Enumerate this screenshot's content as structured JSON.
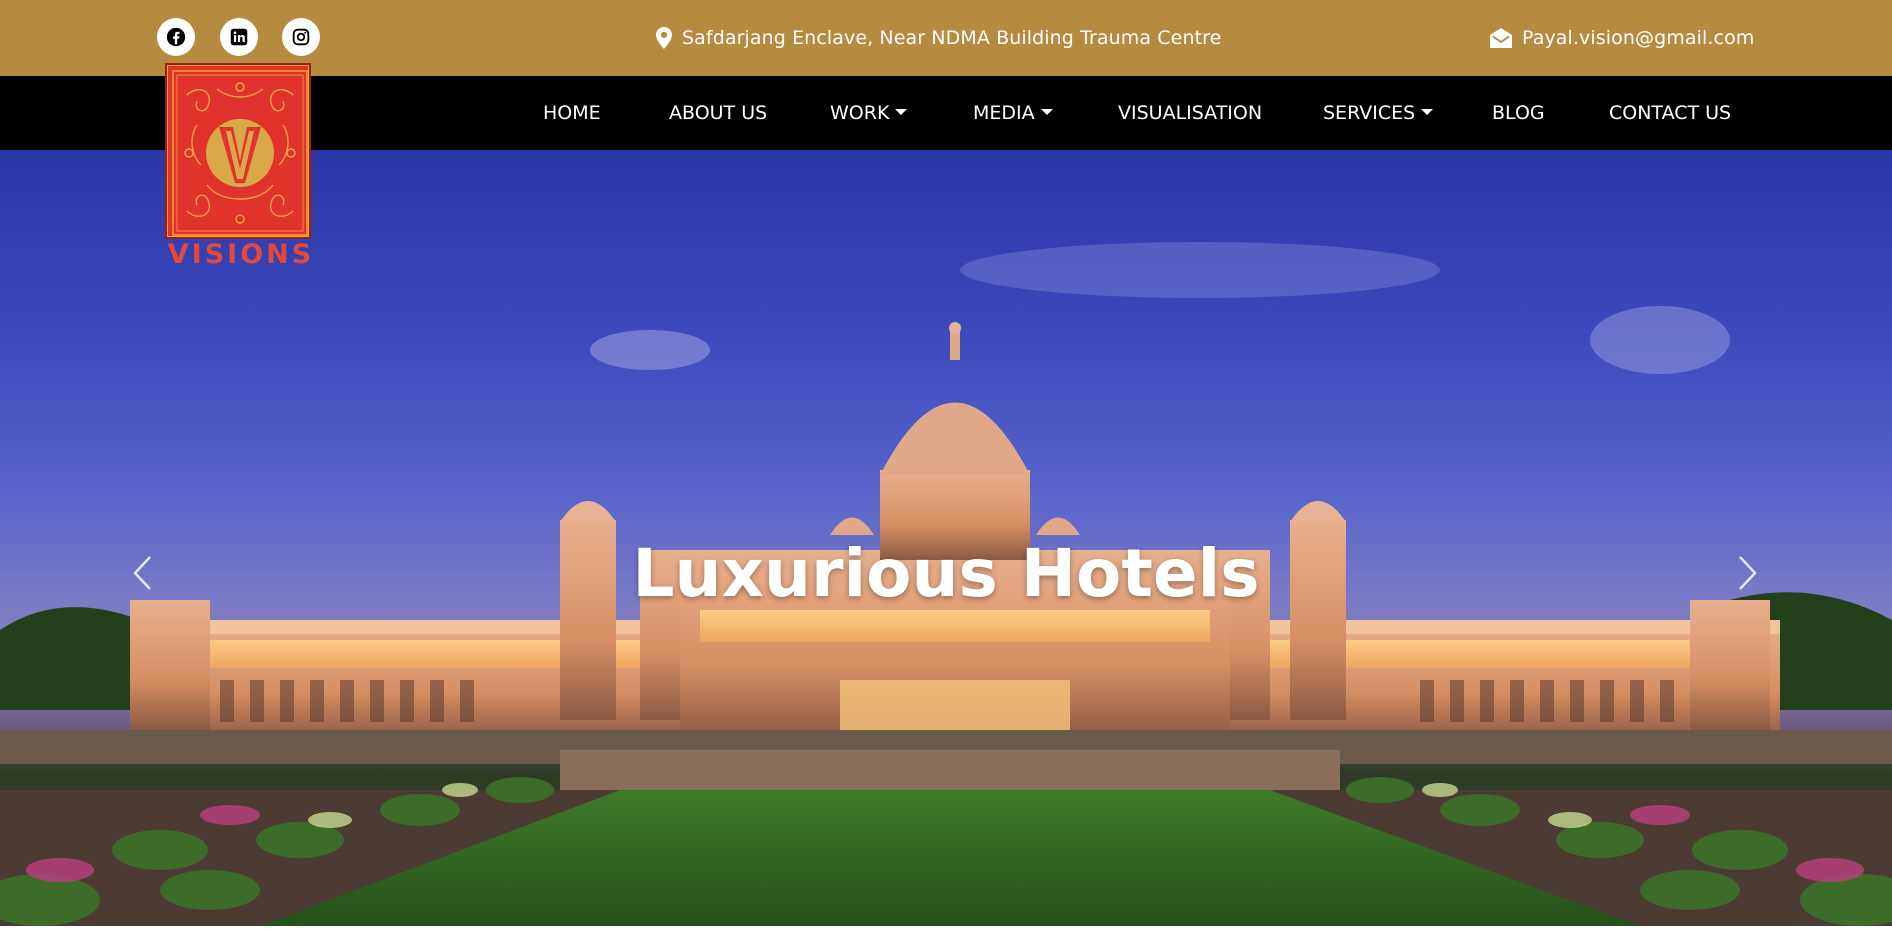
{
  "topbar": {
    "social": [
      {
        "icon": "facebook-icon",
        "label": "Facebook"
      },
      {
        "icon": "linkedin-icon",
        "label": "LinkedIn"
      },
      {
        "icon": "instagram-icon",
        "label": "Instagram"
      }
    ],
    "address": "Safdarjang Enclave, Near NDMA Building Trauma Centre",
    "email": "Payal.vision@gmail.com"
  },
  "brand": {
    "logo_letter": "V",
    "logo_text": "VISIONS"
  },
  "nav": {
    "items": [
      {
        "label": "HOME",
        "dropdown": false
      },
      {
        "label": "ABOUT US",
        "dropdown": false
      },
      {
        "label": "WORK",
        "dropdown": true
      },
      {
        "label": "MEDIA",
        "dropdown": true
      },
      {
        "label": "VISUALISATION",
        "dropdown": false
      },
      {
        "label": "SERVICES",
        "dropdown": true
      },
      {
        "label": "BLOG",
        "dropdown": false
      },
      {
        "label": "CONTACT US",
        "dropdown": false
      }
    ]
  },
  "hero": {
    "title": "Luxurious Hotels",
    "prev_icon": "chevron-left-icon",
    "next_icon": "chevron-right-icon"
  },
  "colors": {
    "topbar": "#b58b40",
    "navbar": "#000000",
    "logo_red": "#e2322c",
    "logo_gold": "#d9a84a"
  }
}
